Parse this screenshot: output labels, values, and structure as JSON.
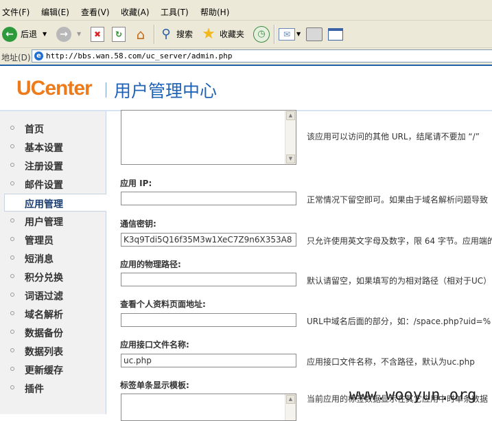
{
  "menubar": {
    "items": [
      "文件(F)",
      "编辑(E)",
      "查看(V)",
      "收藏(A)",
      "工具(T)",
      "帮助(H)"
    ]
  },
  "toolbar": {
    "back_label": "后退",
    "search_label": "搜索",
    "favorites_label": "收藏夹"
  },
  "address": {
    "label": "地址(D)",
    "url": "http://bbs.wan.58.com/uc_server/admin.php"
  },
  "header": {
    "logo": "UCenter",
    "title": "用户管理中心"
  },
  "sidebar": {
    "items": [
      {
        "label": "首页"
      },
      {
        "label": "基本设置"
      },
      {
        "label": "注册设置"
      },
      {
        "label": "邮件设置"
      },
      {
        "label": "应用管理"
      },
      {
        "label": "用户管理"
      },
      {
        "label": "管理员"
      },
      {
        "label": "短消息"
      },
      {
        "label": "积分兑换"
      },
      {
        "label": "词语过滤"
      },
      {
        "label": "域名解析"
      },
      {
        "label": "数据备份"
      },
      {
        "label": "数据列表"
      },
      {
        "label": "更新缓存"
      },
      {
        "label": "插件"
      }
    ],
    "active_index": 4
  },
  "form": {
    "other_url": {
      "hint": "该应用可以访问的其他 URL，结尾请不要加 “/”"
    },
    "app_ip": {
      "label": "应用 IP:",
      "value": "",
      "hint": "正常情况下留空即可。如果由于域名解析问题导致"
    },
    "comm_key": {
      "label": "通信密钥:",
      "value": "K3q9Tdi5Q16f35M3w1XeC7Z9n6X353A8",
      "hint": "只允许使用英文字母及数字，限 64 字节。应用端的"
    },
    "physical_path": {
      "label": "应用的物理路径:",
      "value": "",
      "hint": "默认请留空，如果填写的为相对路径（相对于UC）"
    },
    "profile_url": {
      "label": "查看个人资料页面地址:",
      "value": "",
      "hint": "URL中域名后面的部分，如：/space.php?uid=%"
    },
    "api_filename": {
      "label": "应用接口文件名称:",
      "value": "uc.php",
      "hint": "应用接口文件名称，不含路径，默认为uc.php"
    },
    "tag_template": {
      "label": "标签单条显示模板:",
      "hint": "当前应用的标签数据显示在其它应用中时单条数据"
    }
  },
  "watermark": "www.wooyun.org"
}
